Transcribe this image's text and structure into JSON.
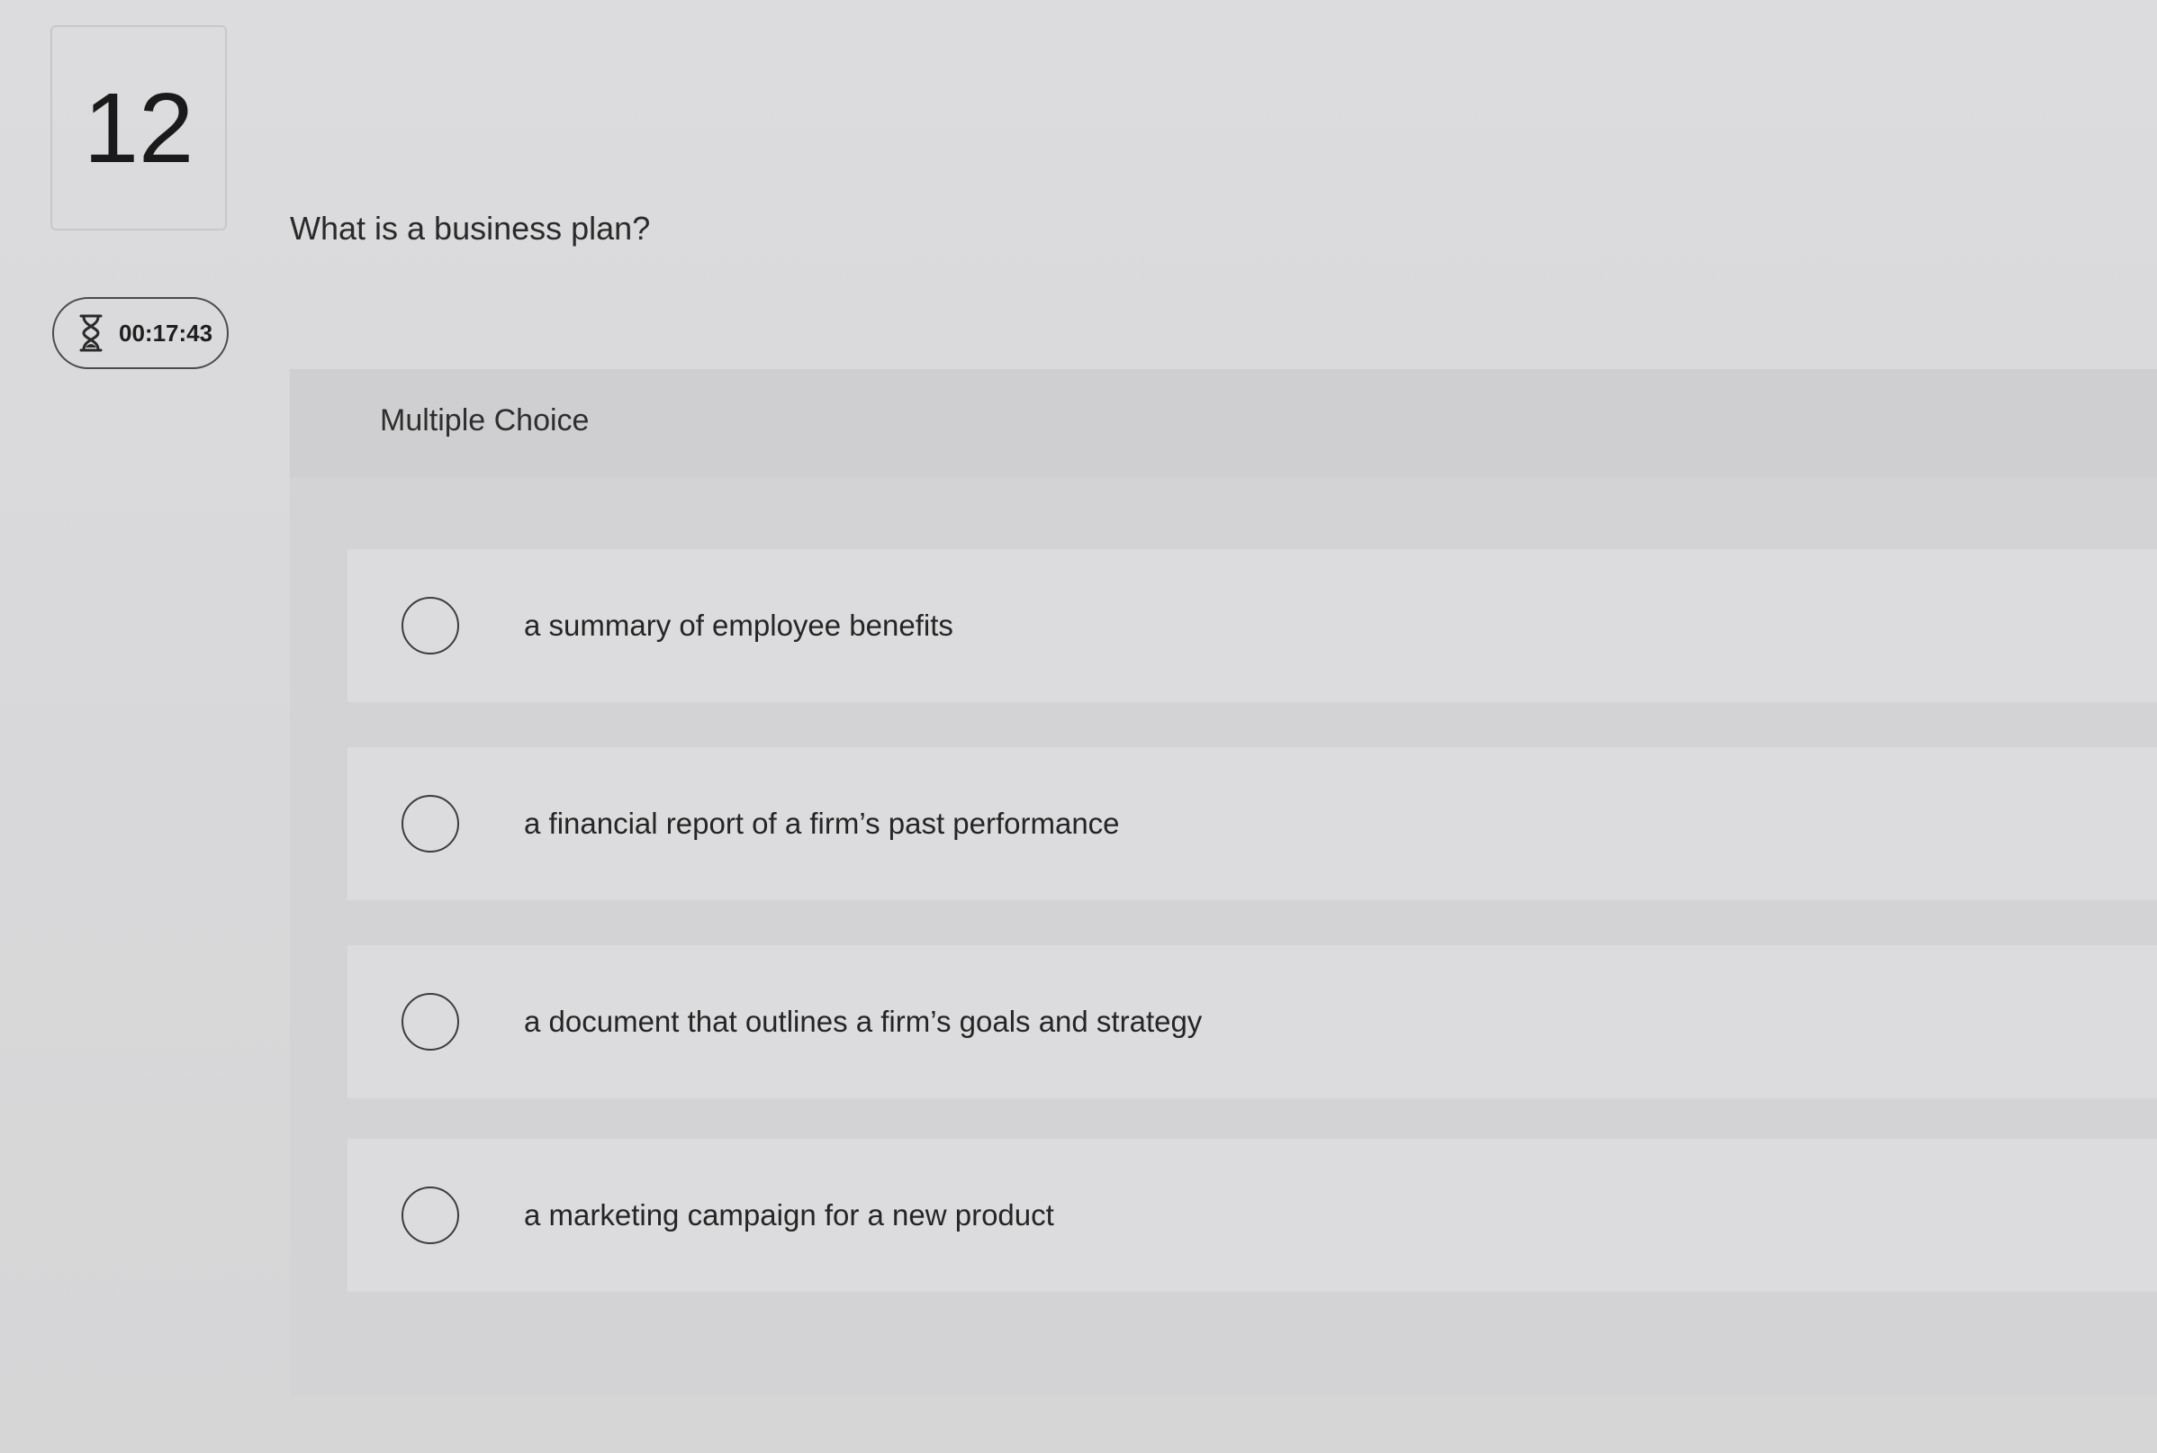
{
  "question_number": "12",
  "timer": {
    "icon": "hourglass-icon",
    "time": "00:17:43"
  },
  "question": {
    "text": "What is a business plan?"
  },
  "answer_panel": {
    "type_label": "Multiple Choice",
    "options": [
      {
        "label": "a summary of employee benefits",
        "selected": false
      },
      {
        "label": "a financial report of a firm’s past performance",
        "selected": false
      },
      {
        "label": "a document that outlines a firm’s goals and strategy",
        "selected": false
      },
      {
        "label": "a marketing campaign for a new product",
        "selected": false
      }
    ]
  }
}
